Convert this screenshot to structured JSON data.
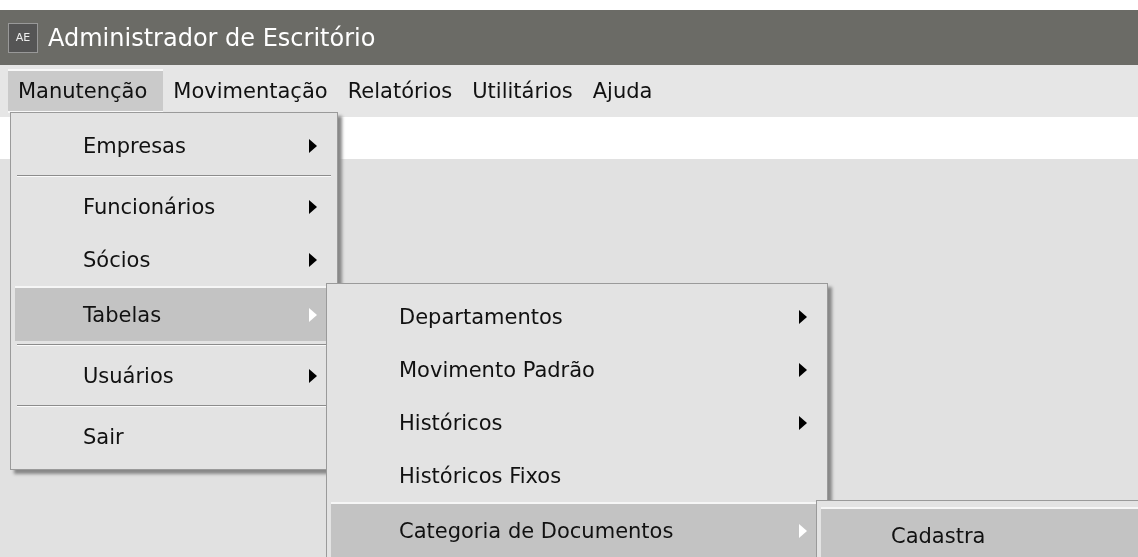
{
  "window": {
    "icon_text": "AE",
    "title": "Administrador de Escritório"
  },
  "menu_bar": [
    {
      "label": "Manutenção",
      "selected": true
    },
    {
      "label": "Movimentação",
      "selected": false
    },
    {
      "label": "Relatórios",
      "selected": false
    },
    {
      "label": "Utilitários",
      "selected": false
    },
    {
      "label": "Ajuda",
      "selected": false
    }
  ],
  "dropdown": {
    "items": [
      {
        "kind": "item",
        "label": "Empresas",
        "has_submenu": true,
        "selected": false
      },
      {
        "kind": "separator"
      },
      {
        "kind": "item",
        "label": "Funcionários",
        "has_submenu": true,
        "selected": false
      },
      {
        "kind": "item",
        "label": "Sócios",
        "has_submenu": true,
        "selected": false
      },
      {
        "kind": "item",
        "label": "Tabelas",
        "has_submenu": true,
        "selected": true,
        "children": [
          {
            "kind": "item",
            "label": "Departamentos",
            "has_submenu": true,
            "selected": false
          },
          {
            "kind": "item",
            "label": "Movimento Padrão",
            "has_submenu": true,
            "selected": false
          },
          {
            "kind": "item",
            "label": "Históricos",
            "has_submenu": true,
            "selected": false
          },
          {
            "kind": "item",
            "label": "Históricos Fixos",
            "has_submenu": false,
            "selected": false
          },
          {
            "kind": "item",
            "label": "Categoria de Documentos",
            "has_submenu": true,
            "selected": true,
            "children": [
              {
                "kind": "item",
                "label": "Cadastra",
                "has_submenu": false,
                "selected": true
              }
            ]
          }
        ]
      },
      {
        "kind": "separator"
      },
      {
        "kind": "item",
        "label": "Usuários",
        "has_submenu": true,
        "selected": false
      },
      {
        "kind": "separator"
      },
      {
        "kind": "item",
        "label": "Sair",
        "has_submenu": false,
        "selected": false
      }
    ]
  }
}
